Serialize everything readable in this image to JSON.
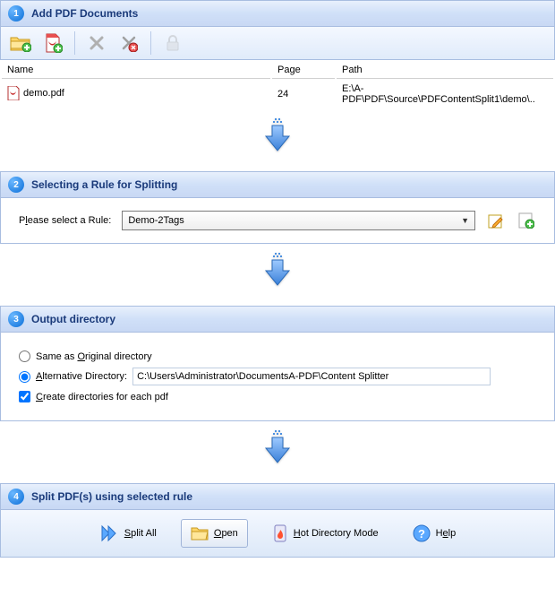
{
  "step1": {
    "num": "1",
    "title": "Add PDF Documents"
  },
  "table": {
    "cols": {
      "name": "Name",
      "page": "Page",
      "path": "Path"
    },
    "row": {
      "name": "demo.pdf",
      "page": "24",
      "path": "E:\\A-PDF\\PDF\\Source\\PDFContentSplit1\\demo\\.."
    }
  },
  "step2": {
    "num": "2",
    "title": "Selecting a Rule for Splitting",
    "label_pre": "P",
    "label_u": "l",
    "label_post": "ease select a Rule:",
    "selected": "Demo-2Tags"
  },
  "step3": {
    "num": "3",
    "title": "Output directory",
    "same_pre": "Same as ",
    "same_u": "O",
    "same_post": "riginal directory",
    "alt_u": "A",
    "alt_post": "lternative Directory:",
    "alt_path": "C:\\Users\\Administrator\\DocumentsA-PDF\\Content Splitter",
    "create_u": "C",
    "create_post": "reate directories for each pdf"
  },
  "step4": {
    "num": "4",
    "title": "Split PDF(s) using selected rule"
  },
  "actions": {
    "split_u": "S",
    "split_post": "plit All",
    "open_u": "O",
    "open_post": "pen",
    "hot_u": "H",
    "hot_post": "ot Directory Mode",
    "help_pre": "H",
    "help_u": "e",
    "help_post": "lp"
  }
}
